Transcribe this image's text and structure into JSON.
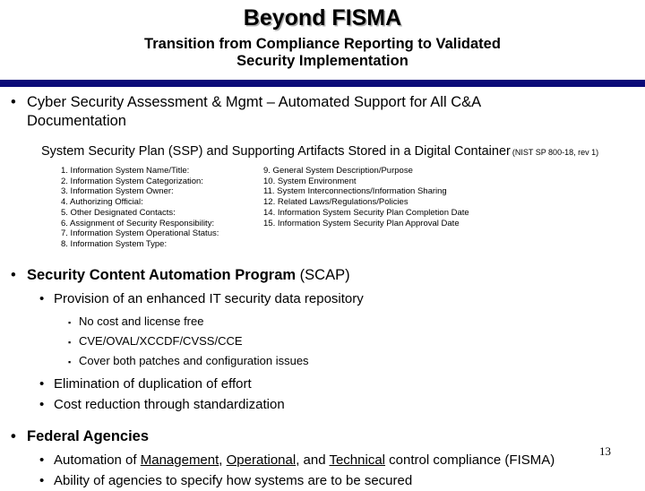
{
  "header": {
    "title": "Beyond FISMA",
    "subtitle_line_1": "Transition from Compliance Reporting to Validated",
    "subtitle_line_2": "Security Implementation",
    "rule_color": "#0a0a78"
  },
  "body": {
    "csam": {
      "marker": "•",
      "line_1": "Cyber Security Assessment & Mgmt – Automated Support for All C&A",
      "line_2": "Documentation",
      "ssp_heading": "System Security Plan (SSP) and Supporting Artifacts Stored in a Digital Container",
      "ssp_reference": "(NIST SP 800-18, rev 1)",
      "ssp_items_left": [
        "1. Information System Name/Title:",
        "2. Information System Categorization:",
        "3. Information System Owner:",
        "4. Authorizing Official:",
        "5. Other Designated Contacts:",
        "6. Assignment of Security Responsibility:",
        "7. Information System Operational Status:",
        "8. Information System Type:"
      ],
      "ssp_items_right": [
        "9. General System Description/Purpose",
        "10. System Environment",
        "11. System Interconnections/Information Sharing",
        "12. Related Laws/Regulations/Policies",
        "14. Information System Security Plan Completion Date",
        "15. Information System Security Plan Approval Date"
      ]
    },
    "scap": {
      "marker": "•",
      "name": "Security Content Automation Program",
      "abbr": " (SCAP)",
      "sub_marker": "•",
      "sub_1": "Provision of an enhanced IT security data repository",
      "l3_marker": "▪",
      "l3_items": [
        "No cost and license free",
        "CVE/OVAL/XCCDF/CVSS/CCE",
        "Cover both patches and configuration issues"
      ],
      "sub_2": "Elimination of duplication of effort",
      "sub_3": "Cost reduction through standardization"
    },
    "federal": {
      "marker": "•",
      "title": "Federal Agencies",
      "sub_marker": "•",
      "sub_1_part_1": "Automation of ",
      "sub_1_u_1": "Management",
      "sub_1_part_2": ", ",
      "sub_1_u_2": "Operational",
      "sub_1_part_3": ", and ",
      "sub_1_u_3": "Technical",
      "sub_1_part_4": " control compliance (FISMA)",
      "sub_2": "Ability of agencies to specify how systems are to be secured"
    }
  },
  "footer": {
    "page_number": "13"
  }
}
